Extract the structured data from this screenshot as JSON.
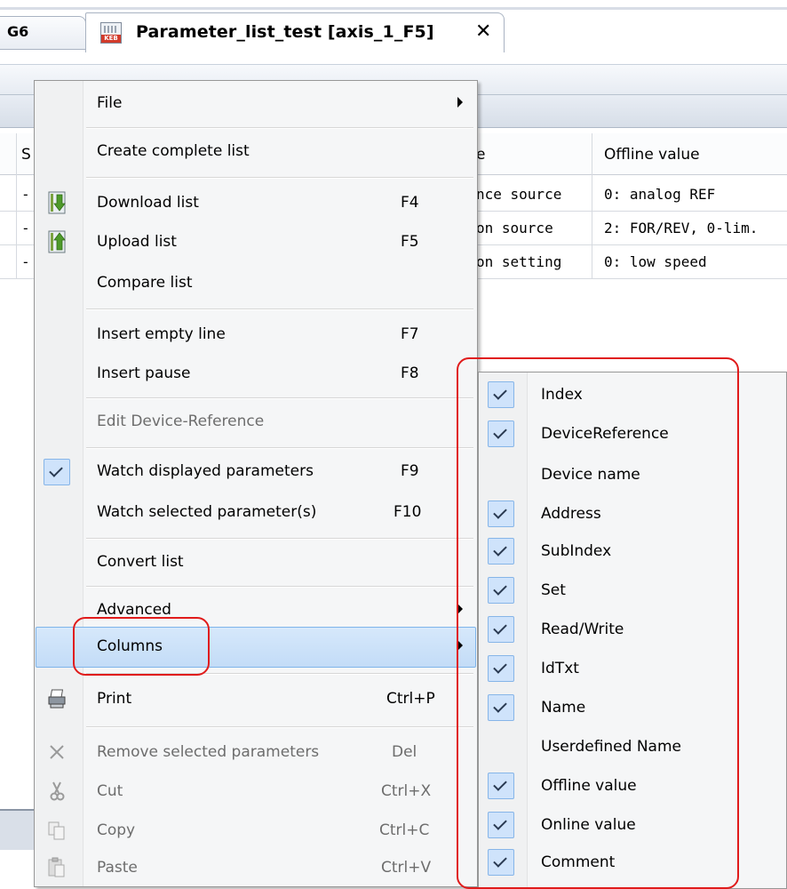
{
  "tabs": {
    "left_tab": "G6",
    "active_tab": "Parameter_list_test [axis_1_F5]",
    "close_glyph": "✕",
    "keb_badge": "KEB"
  },
  "table": {
    "headers": [
      "S",
      "e",
      "Offline value"
    ],
    "rows": [
      {
        "c1": "-",
        "name": "nce source",
        "offline": "0: analog REF"
      },
      {
        "c1": "-",
        "name": "on source",
        "offline": "2: FOR/REV, 0-lim."
      },
      {
        "c1": "-",
        "name": "on setting",
        "offline": "0: low speed"
      }
    ]
  },
  "menu": {
    "file": "File",
    "create_complete_list": "Create complete list",
    "download_list": "Download list",
    "download_sc": "F4",
    "upload_list": "Upload list",
    "upload_sc": "F5",
    "compare_list": "Compare list",
    "insert_empty_line": "Insert empty line",
    "insert_empty_sc": "F7",
    "insert_pause": "Insert pause",
    "insert_pause_sc": "F8",
    "edit_device_reference": "Edit Device-Reference",
    "watch_displayed": "Watch displayed parameters",
    "watch_displayed_sc": "F9",
    "watch_selected": "Watch selected parameter(s)",
    "watch_selected_sc": "F10",
    "convert_list": "Convert list",
    "advanced": "Advanced",
    "columns": "Columns",
    "print": "Print",
    "print_sc": "Ctrl+P",
    "remove_selected": "Remove selected parameters",
    "remove_sc": "Del",
    "cut": "Cut",
    "cut_sc": "Ctrl+X",
    "copy": "Copy",
    "copy_sc": "Ctrl+C",
    "paste": "Paste",
    "paste_sc": "Ctrl+V"
  },
  "columns_submenu": [
    {
      "label": "Index",
      "checked": true
    },
    {
      "label": "DeviceReference",
      "checked": true
    },
    {
      "label": "Device name",
      "checked": false
    },
    {
      "label": "Address",
      "checked": true
    },
    {
      "label": "SubIndex",
      "checked": true
    },
    {
      "label": "Set",
      "checked": true
    },
    {
      "label": "Read/Write",
      "checked": true
    },
    {
      "label": "IdTxt",
      "checked": true
    },
    {
      "label": "Name",
      "checked": true
    },
    {
      "label": "Userdefined Name",
      "checked": false
    },
    {
      "label": "Offline value",
      "checked": true
    },
    {
      "label": "Online value",
      "checked": true
    },
    {
      "label": "Comment",
      "checked": true
    }
  ],
  "colors": {
    "highlight": "#c3dcf7",
    "annotation_red": "#e01b1b",
    "check_bg": "#cfe3fb"
  }
}
